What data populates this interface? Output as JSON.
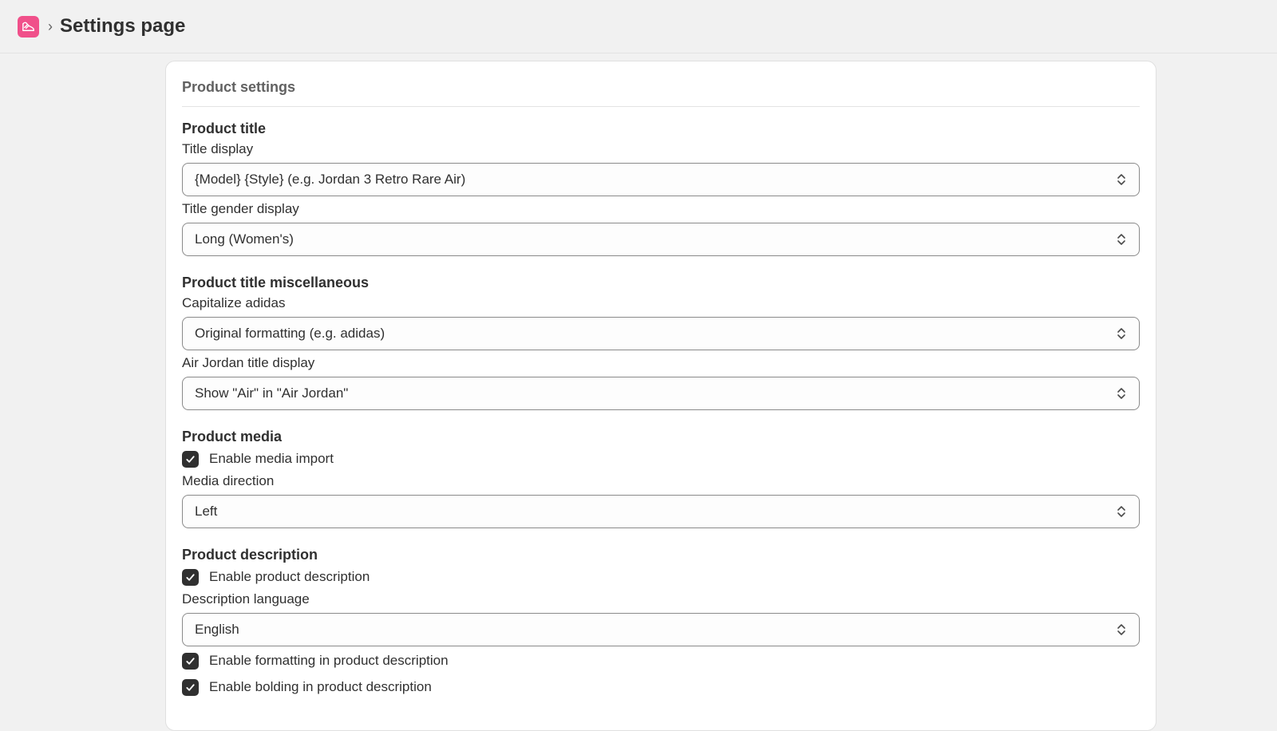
{
  "header": {
    "app_icon": "sneaker-icon",
    "breadcrumb_separator": "›",
    "title": "Settings page"
  },
  "card": {
    "title": "Product settings",
    "sections": {
      "product_title": {
        "heading": "Product title",
        "title_display": {
          "label": "Title display",
          "value": "{Model} {Style} (e.g. Jordan 3 Retro Rare Air)"
        },
        "title_gender_display": {
          "label": "Title gender display",
          "value": "Long (Women's)"
        }
      },
      "product_title_misc": {
        "heading": "Product title miscellaneous",
        "capitalize_adidas": {
          "label": "Capitalize adidas",
          "value": "Original formatting (e.g. adidas)"
        },
        "air_jordan_title": {
          "label": "Air Jordan title display",
          "value": "Show \"Air\" in \"Air Jordan\""
        }
      },
      "product_media": {
        "heading": "Product media",
        "enable_media_import": {
          "label": "Enable media import",
          "checked": true
        },
        "media_direction": {
          "label": "Media direction",
          "value": "Left"
        }
      },
      "product_description": {
        "heading": "Product description",
        "enable_description": {
          "label": "Enable product description",
          "checked": true
        },
        "description_language": {
          "label": "Description language",
          "value": "English"
        },
        "enable_formatting": {
          "label": "Enable formatting in product description",
          "checked": true
        },
        "enable_bolding": {
          "label": "Enable bolding in product description",
          "checked": true
        }
      }
    }
  },
  "colors": {
    "background": "#f1f1f1",
    "card": "#ffffff",
    "app_icon_bg": "#f0508a",
    "checkbox_checked": "#303030",
    "text": "#303030"
  }
}
